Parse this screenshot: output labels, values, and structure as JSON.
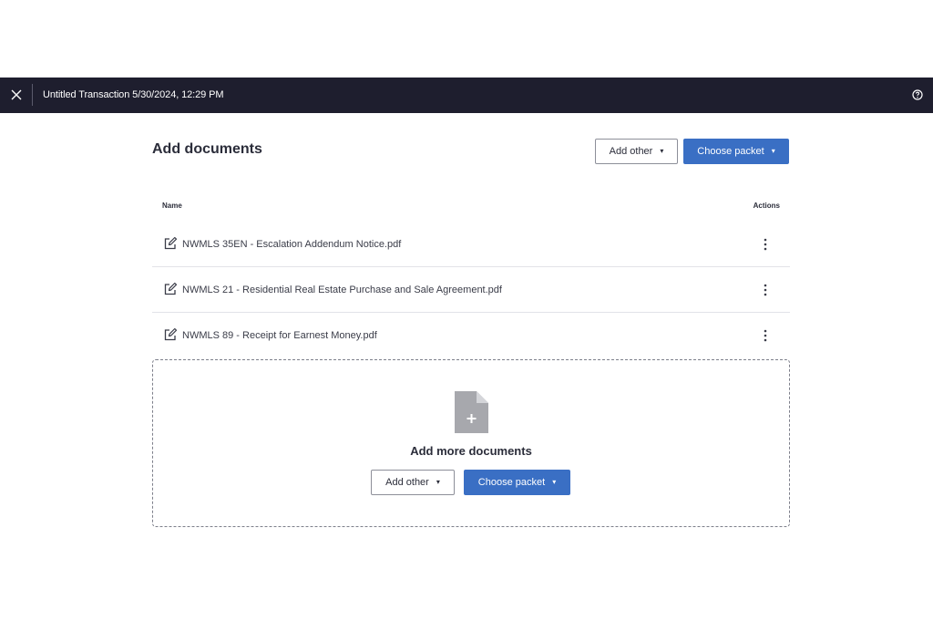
{
  "topbar": {
    "close_icon": "close-icon",
    "title": "Untitled Transaction 5/30/2024, 12:29 PM",
    "help_icon": "help-circle-icon"
  },
  "page": {
    "title": "Add documents",
    "add_other_label": "Add other",
    "choose_packet_label": "Choose packet",
    "caret_glyph": "▾"
  },
  "table": {
    "columns": {
      "name": "Name",
      "actions": "Actions"
    },
    "rows": [
      {
        "name": "NWMLS 35EN - Escalation Addendum Notice.pdf",
        "icon": "edit-document-icon"
      },
      {
        "name": "NWMLS 21 - Residential Real Estate Purchase and Sale Agreement.pdf",
        "icon": "edit-document-icon"
      },
      {
        "name": "NWMLS 89 - Receipt for Earnest Money.pdf",
        "icon": "edit-document-icon"
      }
    ]
  },
  "dropzone": {
    "icon": "add-file-icon",
    "title": "Add more documents",
    "add_other_label": "Add other",
    "choose_packet_label": "Choose packet"
  },
  "colors": {
    "topbar_bg": "#1e1e2e",
    "primary": "#3a6fc4",
    "text": "#2b2d3a",
    "file_icon": "#a7a8ad"
  }
}
